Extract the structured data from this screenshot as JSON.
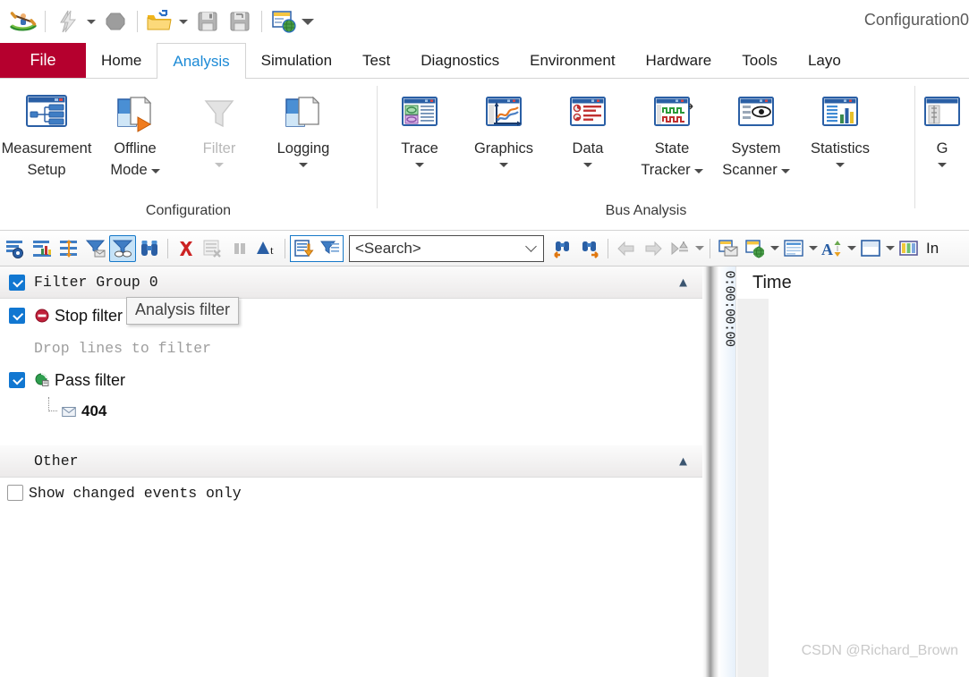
{
  "window": {
    "title": "Configuration0"
  },
  "quick_access": {
    "app_icon": "kayak-app-icon",
    "buttons": [
      {
        "name": "flash-icon",
        "label": "Flash"
      },
      {
        "name": "stop-recording-icon",
        "label": "Stop"
      },
      {
        "name": "open-folder-icon",
        "label": "Open Configuration"
      },
      {
        "name": "save-icon",
        "label": "Save Configuration"
      },
      {
        "name": "save-as-icon",
        "label": "Save Configuration As"
      },
      {
        "name": "publish-web-icon",
        "label": "Publish"
      }
    ],
    "overflow_label": "Customize Quick Access Toolbar"
  },
  "ribbon": {
    "tabs": [
      {
        "label": "File",
        "active": false,
        "is_file": true
      },
      {
        "label": "Home",
        "active": false
      },
      {
        "label": "Analysis",
        "active": true
      },
      {
        "label": "Simulation",
        "active": false
      },
      {
        "label": "Test",
        "active": false
      },
      {
        "label": "Diagnostics",
        "active": false
      },
      {
        "label": "Environment",
        "active": false
      },
      {
        "label": "Hardware",
        "active": false
      },
      {
        "label": "Tools",
        "active": false
      },
      {
        "label": "Layo",
        "active": false
      }
    ],
    "groups": [
      {
        "title": "Configuration",
        "buttons": [
          {
            "label_line1": "Measurement",
            "label_line2": "Setup",
            "icon": "measurement-setup-icon",
            "dropdown": false,
            "disabled": false
          },
          {
            "label_line1": "Offline",
            "label_line2": "Mode",
            "icon": "offline-mode-icon",
            "dropdown": true,
            "disabled": false
          },
          {
            "label_line1": "Filter",
            "label_line2": "",
            "icon": "filter-funnel-icon",
            "dropdown": true,
            "disabled": true
          },
          {
            "label_line1": "Logging",
            "label_line2": "",
            "icon": "logging-icon",
            "dropdown": true,
            "disabled": false
          }
        ]
      },
      {
        "title": "Bus Analysis",
        "buttons": [
          {
            "label_line1": "Trace",
            "label_line2": "",
            "icon": "trace-icon",
            "dropdown": true,
            "disabled": false
          },
          {
            "label_line1": "Graphics",
            "label_line2": "",
            "icon": "graphics-icon",
            "dropdown": true,
            "disabled": false
          },
          {
            "label_line1": "Data",
            "label_line2": "",
            "icon": "data-icon",
            "dropdown": true,
            "disabled": false
          },
          {
            "label_line1": "State",
            "label_line2": "Tracker",
            "icon": "state-tracker-icon",
            "dropdown": true,
            "disabled": false
          },
          {
            "label_line1": "System",
            "label_line2": "Scanner",
            "icon": "system-scanner-icon",
            "dropdown": true,
            "disabled": false
          },
          {
            "label_line1": "Statistics",
            "label_line2": "",
            "icon": "statistics-icon",
            "dropdown": true,
            "disabled": false
          }
        ]
      },
      {
        "title": "",
        "buttons": [
          {
            "label_line1": "G",
            "label_line2": "",
            "icon": "gps-icon",
            "dropdown": true,
            "disabled": false
          }
        ]
      }
    ]
  },
  "toolbar": {
    "left_icons": [
      {
        "name": "filter-settings-icon",
        "selected": false
      },
      {
        "name": "filter-statistics-icon",
        "selected": false
      },
      {
        "name": "filter-resize-icon",
        "selected": false
      },
      {
        "name": "message-filter-icon",
        "selected": false
      },
      {
        "name": "analysis-filter-icon",
        "selected": true
      },
      {
        "name": "find-binoculars-icon",
        "selected": false
      }
    ],
    "mid_icons": [
      {
        "name": "clear-trace-icon",
        "disabled": false
      },
      {
        "name": "clear-list-icon",
        "disabled": true
      },
      {
        "name": "pause-icon",
        "disabled": true
      },
      {
        "name": "delta-time-icon",
        "disabled": false
      }
    ],
    "grouped_icons": [
      {
        "name": "export-trace-icon",
        "selected": true
      },
      {
        "name": "apply-filter-icon",
        "selected": true
      }
    ],
    "search": {
      "placeholder": "<Search>",
      "value": "<Search>",
      "dropdown_icon": "chevron-down-icon"
    },
    "nav_icons": [
      {
        "name": "find-previous-icon"
      },
      {
        "name": "find-next-icon"
      },
      {
        "name": "back-arrow-icon",
        "disabled": true
      },
      {
        "name": "forward-arrow-icon",
        "disabled": true
      },
      {
        "name": "goto-marker-icon",
        "disabled": true
      }
    ],
    "right_icons": [
      {
        "name": "window-layout-icon"
      },
      {
        "name": "web-window-icon",
        "dropdown": true
      },
      {
        "name": "columns-icon",
        "dropdown": true
      },
      {
        "name": "font-size-icon",
        "dropdown": true
      },
      {
        "name": "split-view-icon",
        "dropdown": true
      },
      {
        "name": "color-columns-icon",
        "dropdown": false
      }
    ],
    "right_label": "In"
  },
  "filter_panel": {
    "group": {
      "label": "Filter Group 0",
      "checked": true,
      "collapse_icon": "collapse-chevron-icon"
    },
    "rows": [
      {
        "label": "Stop filter",
        "checked": true,
        "icon": "stop-filter-icon",
        "hint": "Drop lines to filter",
        "children": []
      },
      {
        "label": "Pass filter",
        "checked": true,
        "icon": "pass-filter-icon",
        "hint": "",
        "children": [
          {
            "label": "404",
            "icon": "message-envelope-icon"
          }
        ]
      }
    ],
    "other": {
      "label": "Other",
      "collapse_icon": "collapse-chevron-icon"
    },
    "show_changed": {
      "label": "Show changed events only",
      "checked": false
    },
    "tooltip": {
      "text": "Analysis filter"
    }
  },
  "trace_pane": {
    "time_column_header": "Time",
    "time_value": "0:00:00:00"
  },
  "watermark": {
    "text": "CSDN @Richard_Brown"
  },
  "colors": {
    "file_tab": "#b5002e",
    "active_tab_text": "#1c8ad6",
    "checkbox": "#1177d1",
    "selection": "#c5e2f7",
    "selection_border": "#1678c8"
  }
}
